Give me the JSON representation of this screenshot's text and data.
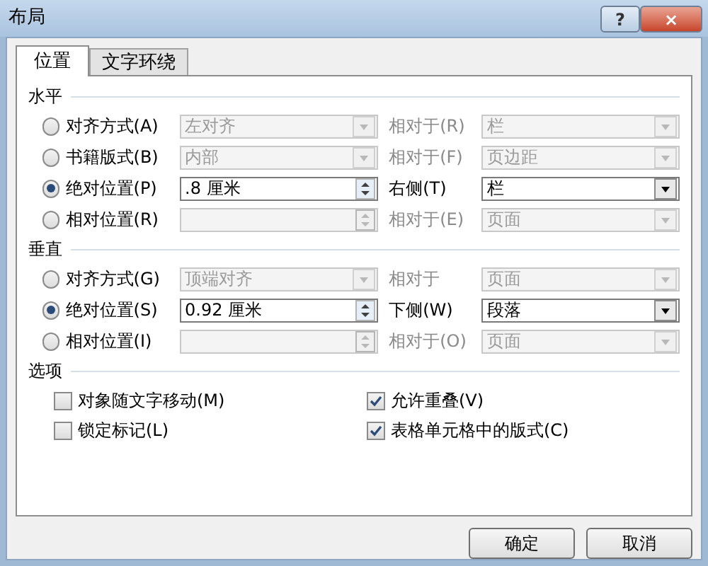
{
  "window": {
    "title": "布局",
    "buttons": [
      "?",
      "×"
    ]
  },
  "tabs": [
    {
      "label": "位置",
      "selected": true
    },
    {
      "label": "文字环绕",
      "selected": false
    }
  ],
  "groups": [
    {
      "title": "水平",
      "rows": [
        {
          "label": "对齐方式(A)",
          "selected": false,
          "kind": "dropdown",
          "value": "左对齐",
          "relation_label": "相对于(R)",
          "relation_value": "栏"
        },
        {
          "label": "书籍版式(B)",
          "selected": false,
          "kind": "dropdown",
          "value": "内部",
          "relation_label": "相对于(F)",
          "relation_value": "页边距"
        },
        {
          "label": "绝对位置(P)",
          "selected": true,
          "kind": "spin",
          "value": ".8 厘米",
          "relation_label": "右侧(T)",
          "relation_value": "栏"
        },
        {
          "label": "相对位置(R)",
          "selected": false,
          "kind": "spin",
          "value": "",
          "relation_label": "相对于(E)",
          "relation_value": "页面"
        }
      ]
    },
    {
      "title": "垂直",
      "rows": [
        {
          "label": "对齐方式(G)",
          "selected": false,
          "kind": "dropdown",
          "value": "顶端对齐",
          "relation_label": "相对于",
          "relation_value": "页面"
        },
        {
          "label": "绝对位置(S)",
          "selected": true,
          "kind": "spin",
          "value": "0.92 厘米",
          "relation_label": "下侧(W)",
          "relation_value": "段落"
        },
        {
          "label": "相对位置(I)",
          "selected": false,
          "kind": "spin",
          "value": "",
          "relation_label": "相对于(O)",
          "relation_value": "页面"
        }
      ]
    }
  ],
  "options": {
    "title": "选项",
    "checkboxes": [
      {
        "label": "对象随文字移动(M)",
        "checked": false
      },
      {
        "label": "允许重叠(V)",
        "checked": true
      },
      {
        "label": "锁定标记(L)",
        "checked": false
      },
      {
        "label": "表格单元格中的版式(C)",
        "checked": true
      }
    ]
  },
  "buttons": [
    "确定",
    "取消"
  ]
}
